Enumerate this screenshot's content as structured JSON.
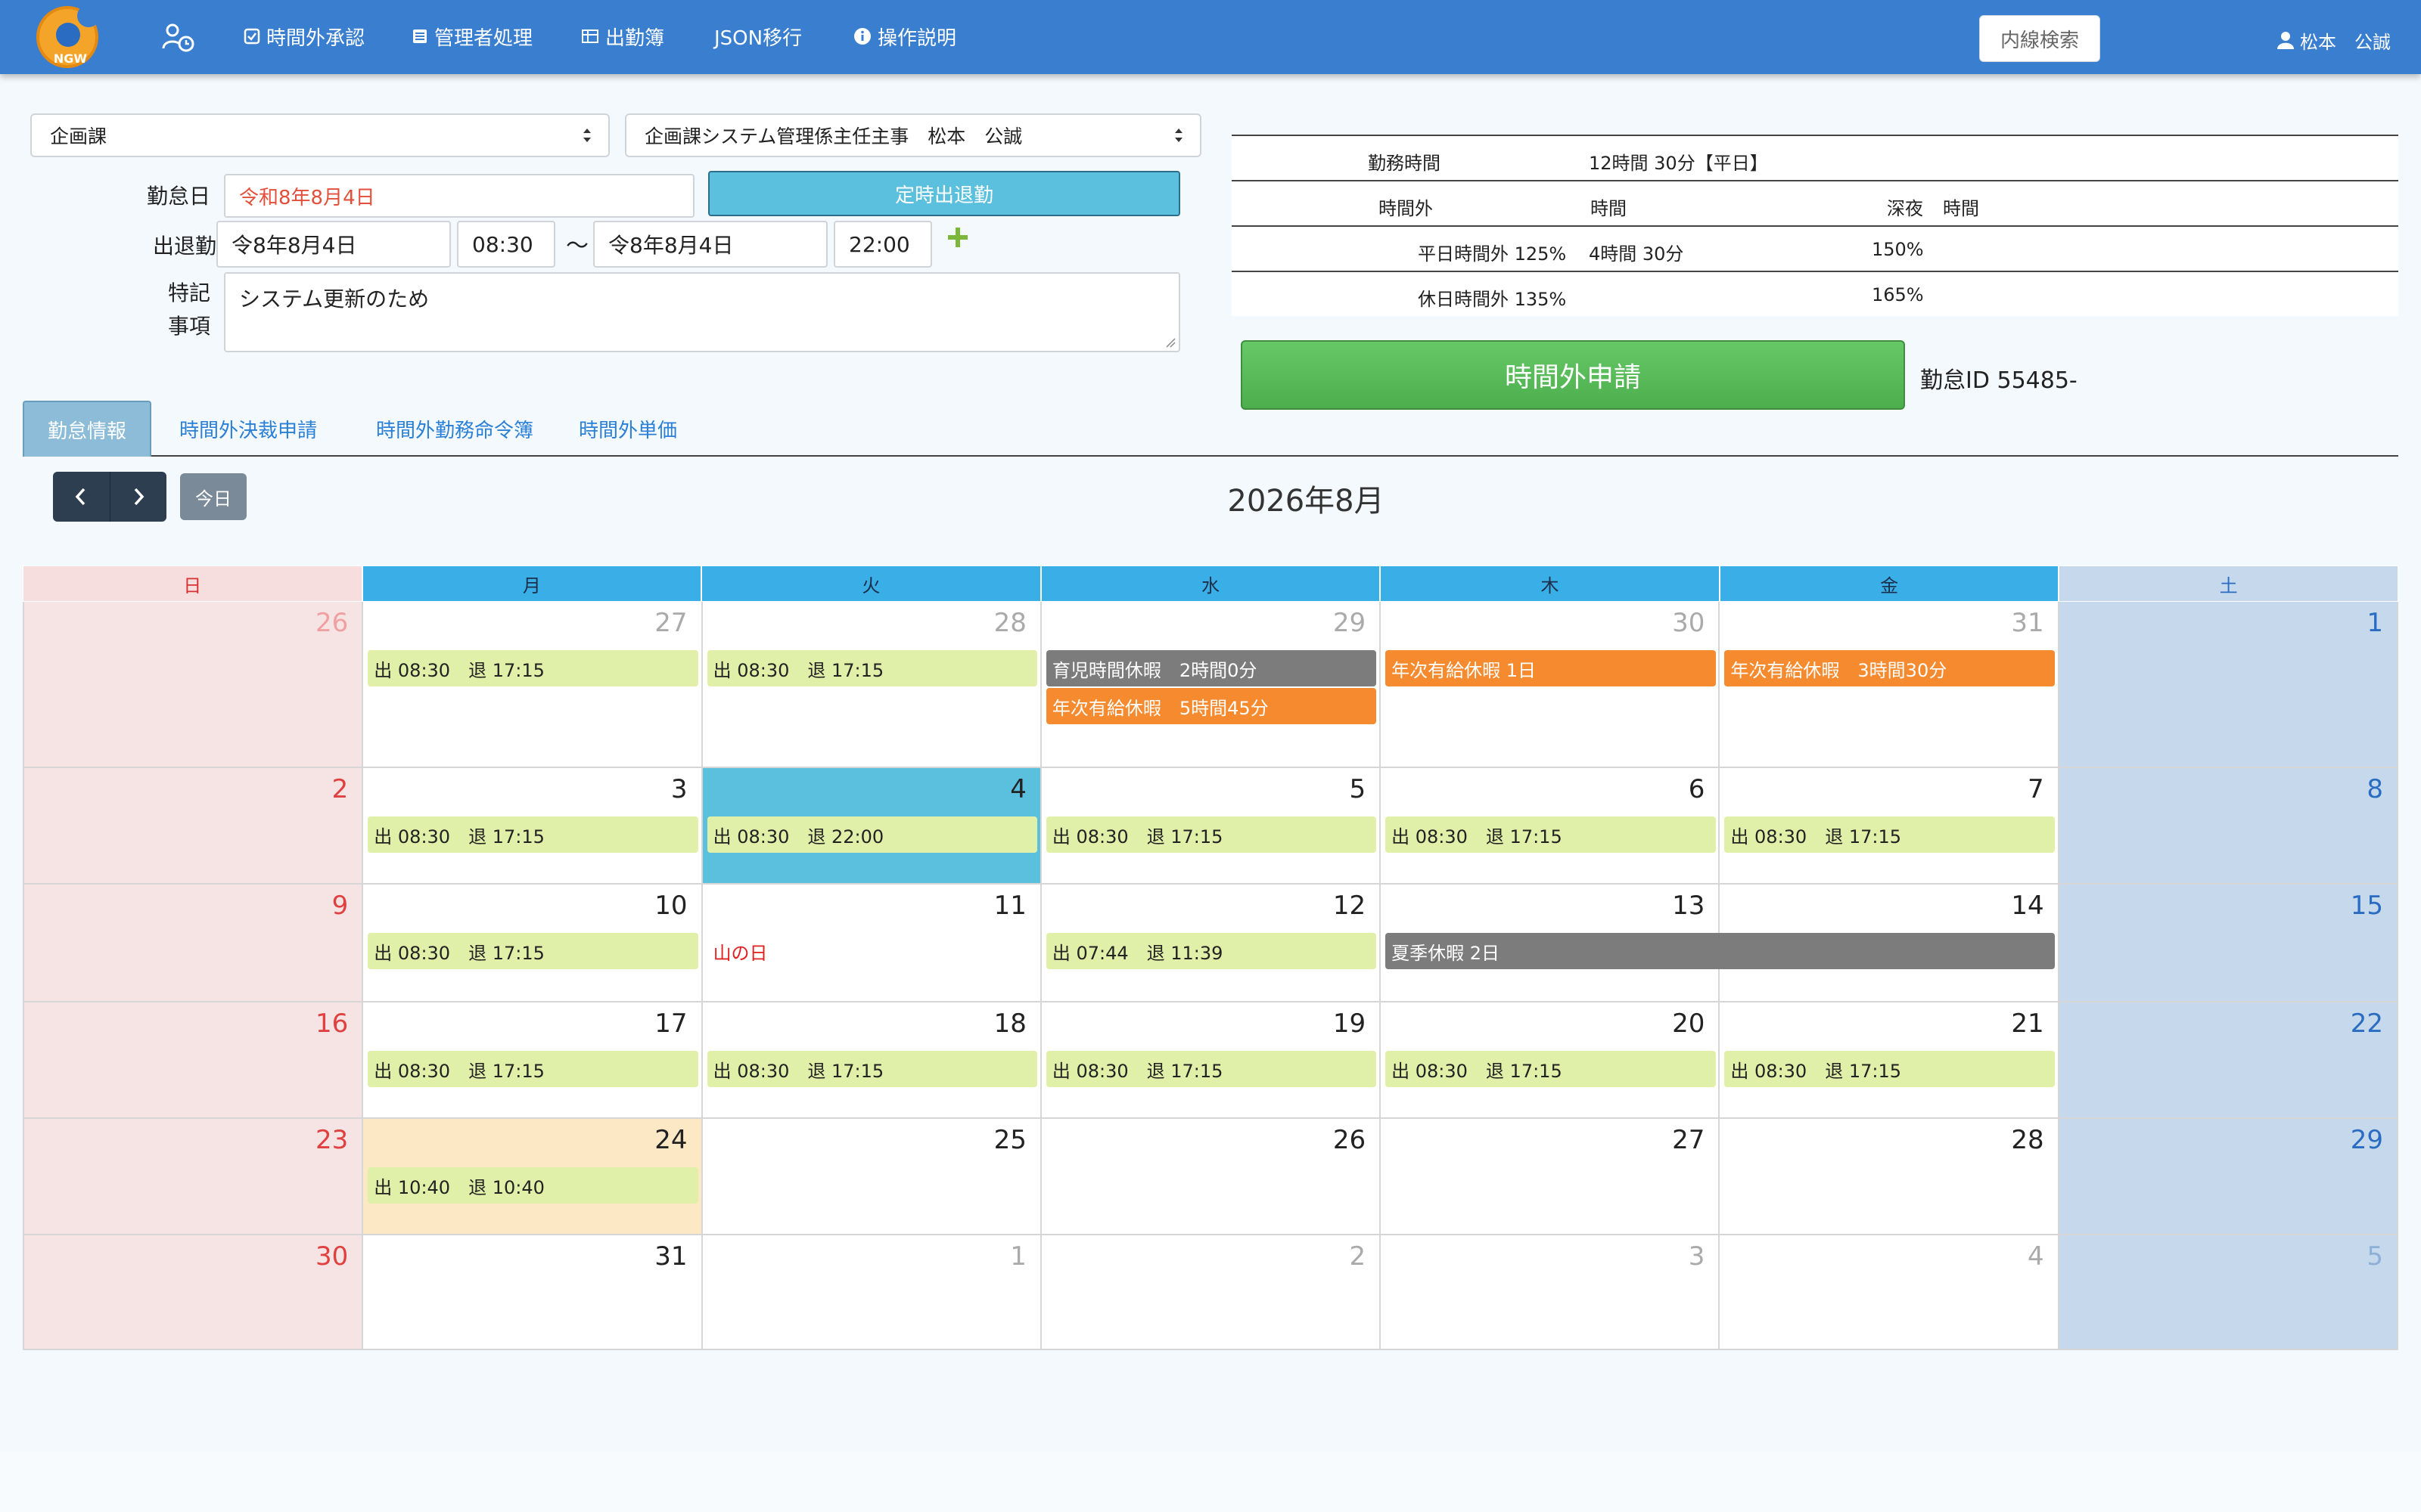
{
  "navbar": {
    "logo_text": "NGW",
    "items": [
      {
        "label": "時間外承認",
        "icon": "check-square-icon"
      },
      {
        "label": "管理者処理",
        "icon": "list-icon"
      },
      {
        "label": "出勤簿",
        "icon": "table-icon"
      },
      {
        "label": "JSON移行",
        "icon": ""
      },
      {
        "label": "操作説明",
        "icon": "info-icon"
      }
    ],
    "search_button": "内線検索",
    "user_name": "松本　公誠"
  },
  "form": {
    "dept_select": "企画課",
    "person_select": "企画課システム管理係主任主事　松本　公誠",
    "labels": {
      "date": "勤怠日",
      "attend": "出退勤",
      "notes_line1": "特記",
      "notes_line2": "事項"
    },
    "date_value": "令和8年8月4日",
    "btn_teiji": "定時出退勤",
    "start_date": "令8年8月4日",
    "start_time": "08:30",
    "tilde": "〜",
    "end_date": "令8年8月4日",
    "end_time": "22:00",
    "notes": "システム更新のため"
  },
  "summary": {
    "work_label": "勤務時間",
    "work_value": "12時間 30分【平日】",
    "ot_label": "時間外",
    "hours_label": "時間",
    "night_label": "深夜",
    "night_hours_label": "時間",
    "weekday_label": "平日時間外 125%",
    "weekday_hours": "4時間 30分",
    "weekday_night": "150%",
    "holiday_label": "休日時間外 135%",
    "holiday_night": "165%"
  },
  "apply_button": "時間外申請",
  "attendance_id": "勤怠ID 55485-",
  "tabs": [
    "勤怠情報",
    "時間外決裁申請",
    "時間外勤務命令簿",
    "時間外単価"
  ],
  "calendar": {
    "today_button": "今日",
    "title": "2026年8月",
    "weekdays": [
      "日",
      "月",
      "火",
      "水",
      "木",
      "金",
      "土"
    ],
    "weeks": [
      [
        {
          "day": "26",
          "other": true,
          "events": []
        },
        {
          "day": "27",
          "other": true,
          "events": [
            {
              "text": "出 08:30　退 17:15",
              "type": "work"
            }
          ]
        },
        {
          "day": "28",
          "other": true,
          "events": [
            {
              "text": "出 08:30　退 17:15",
              "type": "work"
            }
          ]
        },
        {
          "day": "29",
          "other": true,
          "events": [
            {
              "text": "育児時間休暇　2時間0分",
              "type": "gray"
            },
            {
              "text": "年次有給休暇　5時間45分",
              "type": "orange"
            }
          ]
        },
        {
          "day": "30",
          "other": true,
          "events": [
            {
              "text": "年次有給休暇 1日",
              "type": "orange"
            }
          ]
        },
        {
          "day": "31",
          "other": true,
          "events": [
            {
              "text": "年次有給休暇　3時間30分",
              "type": "orange"
            }
          ]
        },
        {
          "day": "1",
          "other": false,
          "events": []
        }
      ],
      [
        {
          "day": "2",
          "other": false,
          "events": []
        },
        {
          "day": "3",
          "other": false,
          "events": [
            {
              "text": "出 08:30　退 17:15",
              "type": "work"
            }
          ]
        },
        {
          "day": "4",
          "other": false,
          "selected": true,
          "events": [
            {
              "text": "出 08:30　退 22:00",
              "type": "work"
            }
          ]
        },
        {
          "day": "5",
          "other": false,
          "events": [
            {
              "text": "出 08:30　退 17:15",
              "type": "work"
            }
          ]
        },
        {
          "day": "6",
          "other": false,
          "events": [
            {
              "text": "出 08:30　退 17:15",
              "type": "work"
            }
          ]
        },
        {
          "day": "7",
          "other": false,
          "events": [
            {
              "text": "出 08:30　退 17:15",
              "type": "work"
            }
          ]
        },
        {
          "day": "8",
          "other": false,
          "events": []
        }
      ],
      [
        {
          "day": "9",
          "other": false,
          "events": []
        },
        {
          "day": "10",
          "other": false,
          "events": [
            {
              "text": "出 08:30　退 17:15",
              "type": "work"
            }
          ]
        },
        {
          "day": "11",
          "other": false,
          "events": [
            {
              "text": "山の日",
              "type": "holiday"
            }
          ]
        },
        {
          "day": "12",
          "other": false,
          "events": [
            {
              "text": "出 07:44　退 11:39",
              "type": "work"
            }
          ]
        },
        {
          "day": "13",
          "other": false,
          "events": [
            {
              "text": "夏季休暇 2日",
              "type": "gray",
              "span": 2
            }
          ]
        },
        {
          "day": "14",
          "other": false,
          "events": []
        },
        {
          "day": "15",
          "other": false,
          "events": []
        }
      ],
      [
        {
          "day": "16",
          "other": false,
          "events": []
        },
        {
          "day": "17",
          "other": false,
          "events": [
            {
              "text": "出 08:30　退 17:15",
              "type": "work"
            }
          ]
        },
        {
          "day": "18",
          "other": false,
          "events": [
            {
              "text": "出 08:30　退 17:15",
              "type": "work"
            }
          ]
        },
        {
          "day": "19",
          "other": false,
          "events": [
            {
              "text": "出 08:30　退 17:15",
              "type": "work"
            }
          ]
        },
        {
          "day": "20",
          "other": false,
          "events": [
            {
              "text": "出 08:30　退 17:15",
              "type": "work"
            }
          ]
        },
        {
          "day": "21",
          "other": false,
          "events": [
            {
              "text": "出 08:30　退 17:15",
              "type": "work"
            }
          ]
        },
        {
          "day": "22",
          "other": false,
          "events": []
        }
      ],
      [
        {
          "day": "23",
          "other": false,
          "events": []
        },
        {
          "day": "24",
          "other": false,
          "today": true,
          "events": [
            {
              "text": "出 10:40　退 10:40",
              "type": "work"
            }
          ]
        },
        {
          "day": "25",
          "other": false,
          "events": []
        },
        {
          "day": "26",
          "other": false,
          "events": []
        },
        {
          "day": "27",
          "other": false,
          "events": []
        },
        {
          "day": "28",
          "other": false,
          "events": []
        },
        {
          "day": "29",
          "other": false,
          "events": []
        }
      ],
      [
        {
          "day": "30",
          "other": false,
          "events": []
        },
        {
          "day": "31",
          "other": false,
          "events": []
        },
        {
          "day": "1",
          "other": true,
          "events": []
        },
        {
          "day": "2",
          "other": true,
          "events": []
        },
        {
          "day": "3",
          "other": true,
          "events": []
        },
        {
          "day": "4",
          "other": true,
          "events": []
        },
        {
          "day": "5",
          "other": true,
          "events": []
        }
      ]
    ]
  }
}
